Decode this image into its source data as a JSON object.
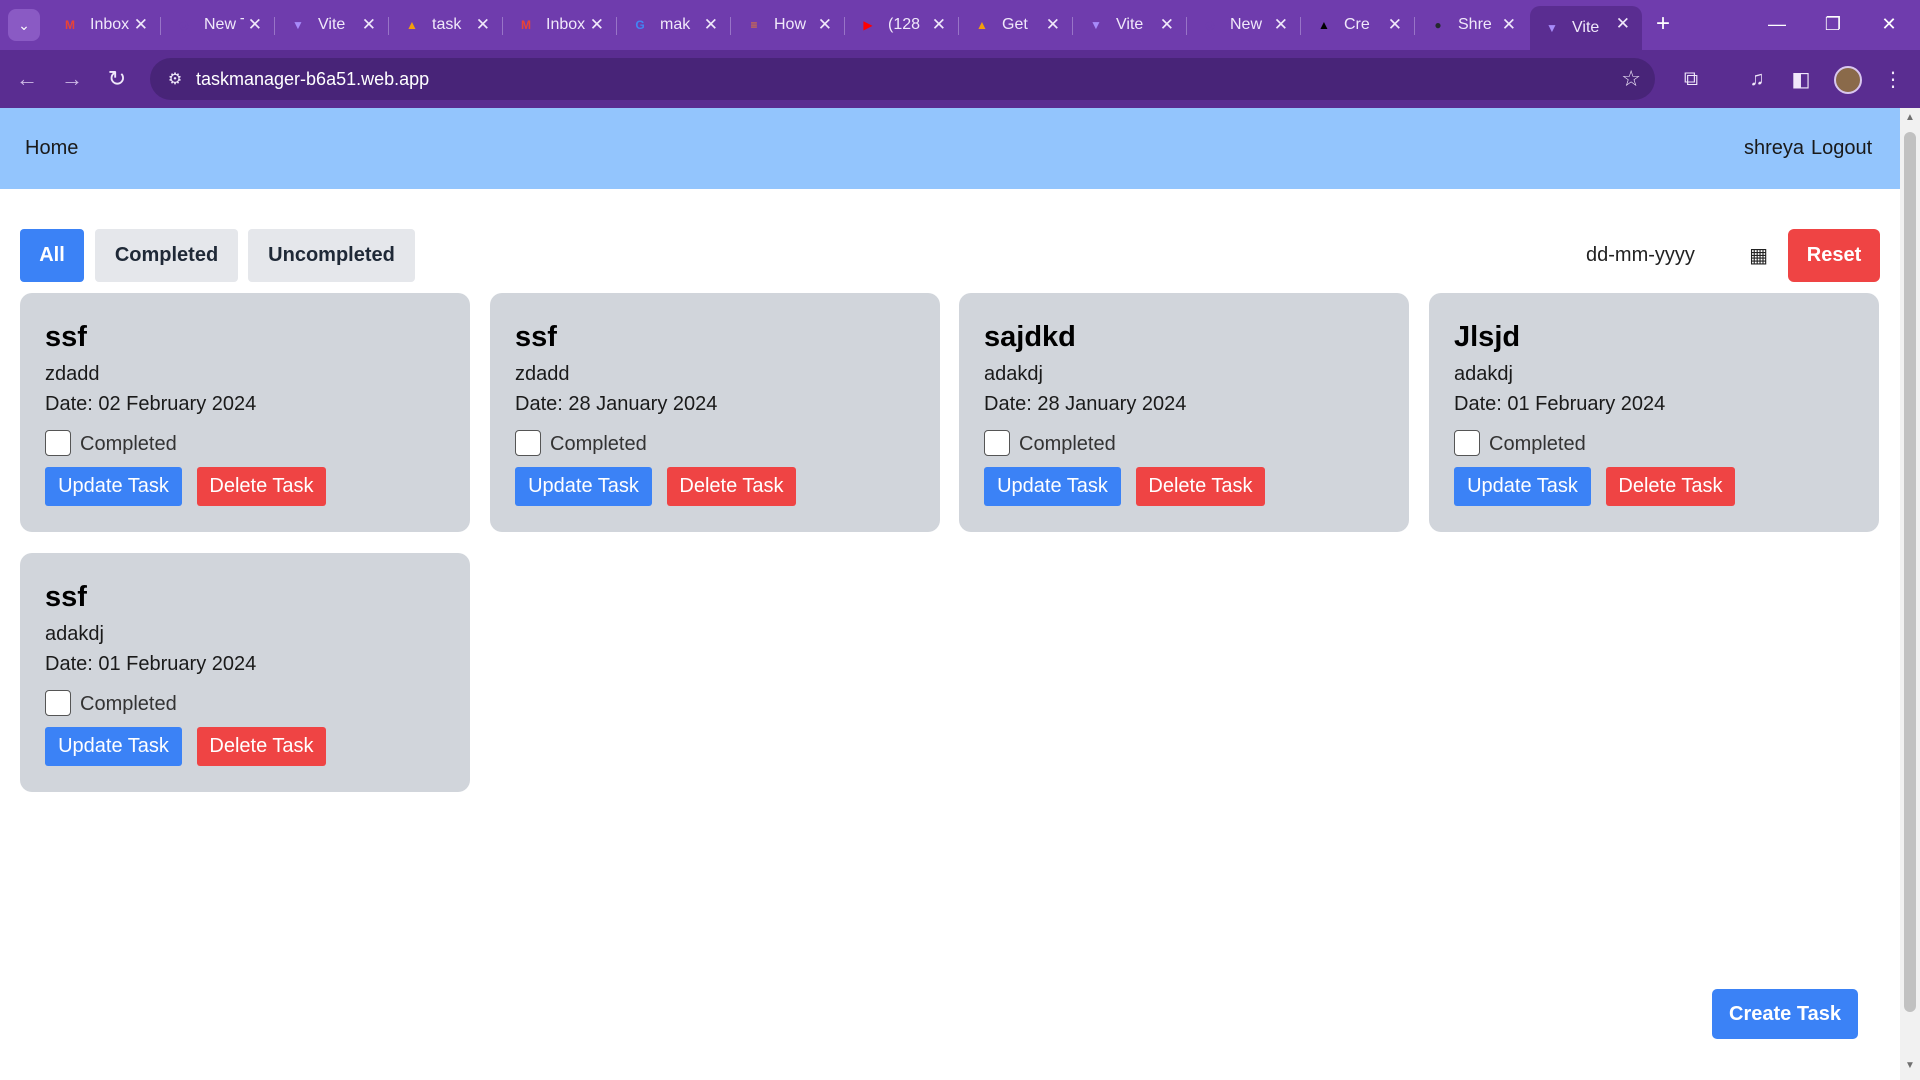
{
  "browser": {
    "tabs": [
      {
        "icon": "gmail-icon",
        "fav_text": "M",
        "fav_color": "#ea4335",
        "title": "Inbox"
      },
      {
        "icon": "chrome-icon",
        "fav_text": "◎",
        "fav_color": "#6f3cad",
        "title": "New Tab"
      },
      {
        "icon": "vite-icon",
        "fav_text": "▼",
        "fav_color": "#a78bfa",
        "title": "Vite"
      },
      {
        "icon": "firebase-icon",
        "fav_text": "▲",
        "fav_color": "#f59e0b",
        "title": "task"
      },
      {
        "icon": "gmail-icon",
        "fav_text": "M",
        "fav_color": "#ea4335",
        "title": "Inbox"
      },
      {
        "icon": "google-icon",
        "fav_text": "G",
        "fav_color": "#4285f4",
        "title": "mak"
      },
      {
        "icon": "stackoverflow-icon",
        "fav_text": "≡",
        "fav_color": "#f48024",
        "title": "How"
      },
      {
        "icon": "youtube-icon",
        "fav_text": "▶",
        "fav_color": "#ff0000",
        "title": "(128"
      },
      {
        "icon": "firebase-icon",
        "fav_text": "▲",
        "fav_color": "#f59e0b",
        "title": "Get"
      },
      {
        "icon": "vite-icon",
        "fav_text": "▼",
        "fav_color": "#a78bfa",
        "title": "Vite"
      },
      {
        "icon": "chrome-icon",
        "fav_text": "◎",
        "fav_color": "#6f3cad",
        "title": "New"
      },
      {
        "icon": "vercel-icon",
        "fav_text": "▲",
        "fav_color": "#000000",
        "title": "Cre"
      },
      {
        "icon": "github-icon",
        "fav_text": "●",
        "fav_color": "#24292f",
        "title": "Shre"
      },
      {
        "icon": "vite-icon",
        "fav_text": "▼",
        "fav_color": "#a78bfa",
        "title": "Vite"
      }
    ],
    "url": "taskmanager-b6a51.web.app",
    "close_glyph": "✕",
    "new_tab_glyph": "+",
    "minimize_glyph": "—",
    "restore_glyph": "❐",
    "window_close_glyph": "✕"
  },
  "navbar": {
    "home": "Home",
    "user": "shreya",
    "logout": "Logout"
  },
  "filters": {
    "all": "All",
    "completed": "Completed",
    "uncompleted": "Uncompleted",
    "active": "All"
  },
  "date_filter": {
    "placeholder": "dd-mm-yyyy"
  },
  "reset_label": "Reset",
  "tasks": [
    {
      "title": "ssf",
      "description": "zdadd",
      "date": "Date: 02 February 2024",
      "completed_label": "Completed",
      "completed": false,
      "update_label": "Update Task",
      "delete_label": "Delete Task"
    },
    {
      "title": "ssf",
      "description": "zdadd",
      "date": "Date: 28 January 2024",
      "completed_label": "Completed",
      "completed": false,
      "update_label": "Update Task",
      "delete_label": "Delete Task"
    },
    {
      "title": "sajdkd",
      "description": "adakdj",
      "date": "Date: 28 January 2024",
      "completed_label": "Completed",
      "completed": false,
      "update_label": "Update Task",
      "delete_label": "Delete Task"
    },
    {
      "title": "Jlsjd",
      "description": "adakdj",
      "date": "Date: 01 February 2024",
      "completed_label": "Completed",
      "completed": false,
      "update_label": "Update Task",
      "delete_label": "Delete Task"
    },
    {
      "title": "ssf",
      "description": "adakdj",
      "date": "Date: 01 February 2024",
      "completed_label": "Completed",
      "completed": false,
      "update_label": "Update Task",
      "delete_label": "Delete Task"
    }
  ],
  "create_label": "Create Task",
  "colors": {
    "chrome_tabstrip": "#6f3cad",
    "chrome_toolbar": "#5a2d91",
    "navbar": "#93c5fd",
    "primary": "#3b82f6",
    "danger": "#ef4444",
    "card": "#d1d5db"
  }
}
